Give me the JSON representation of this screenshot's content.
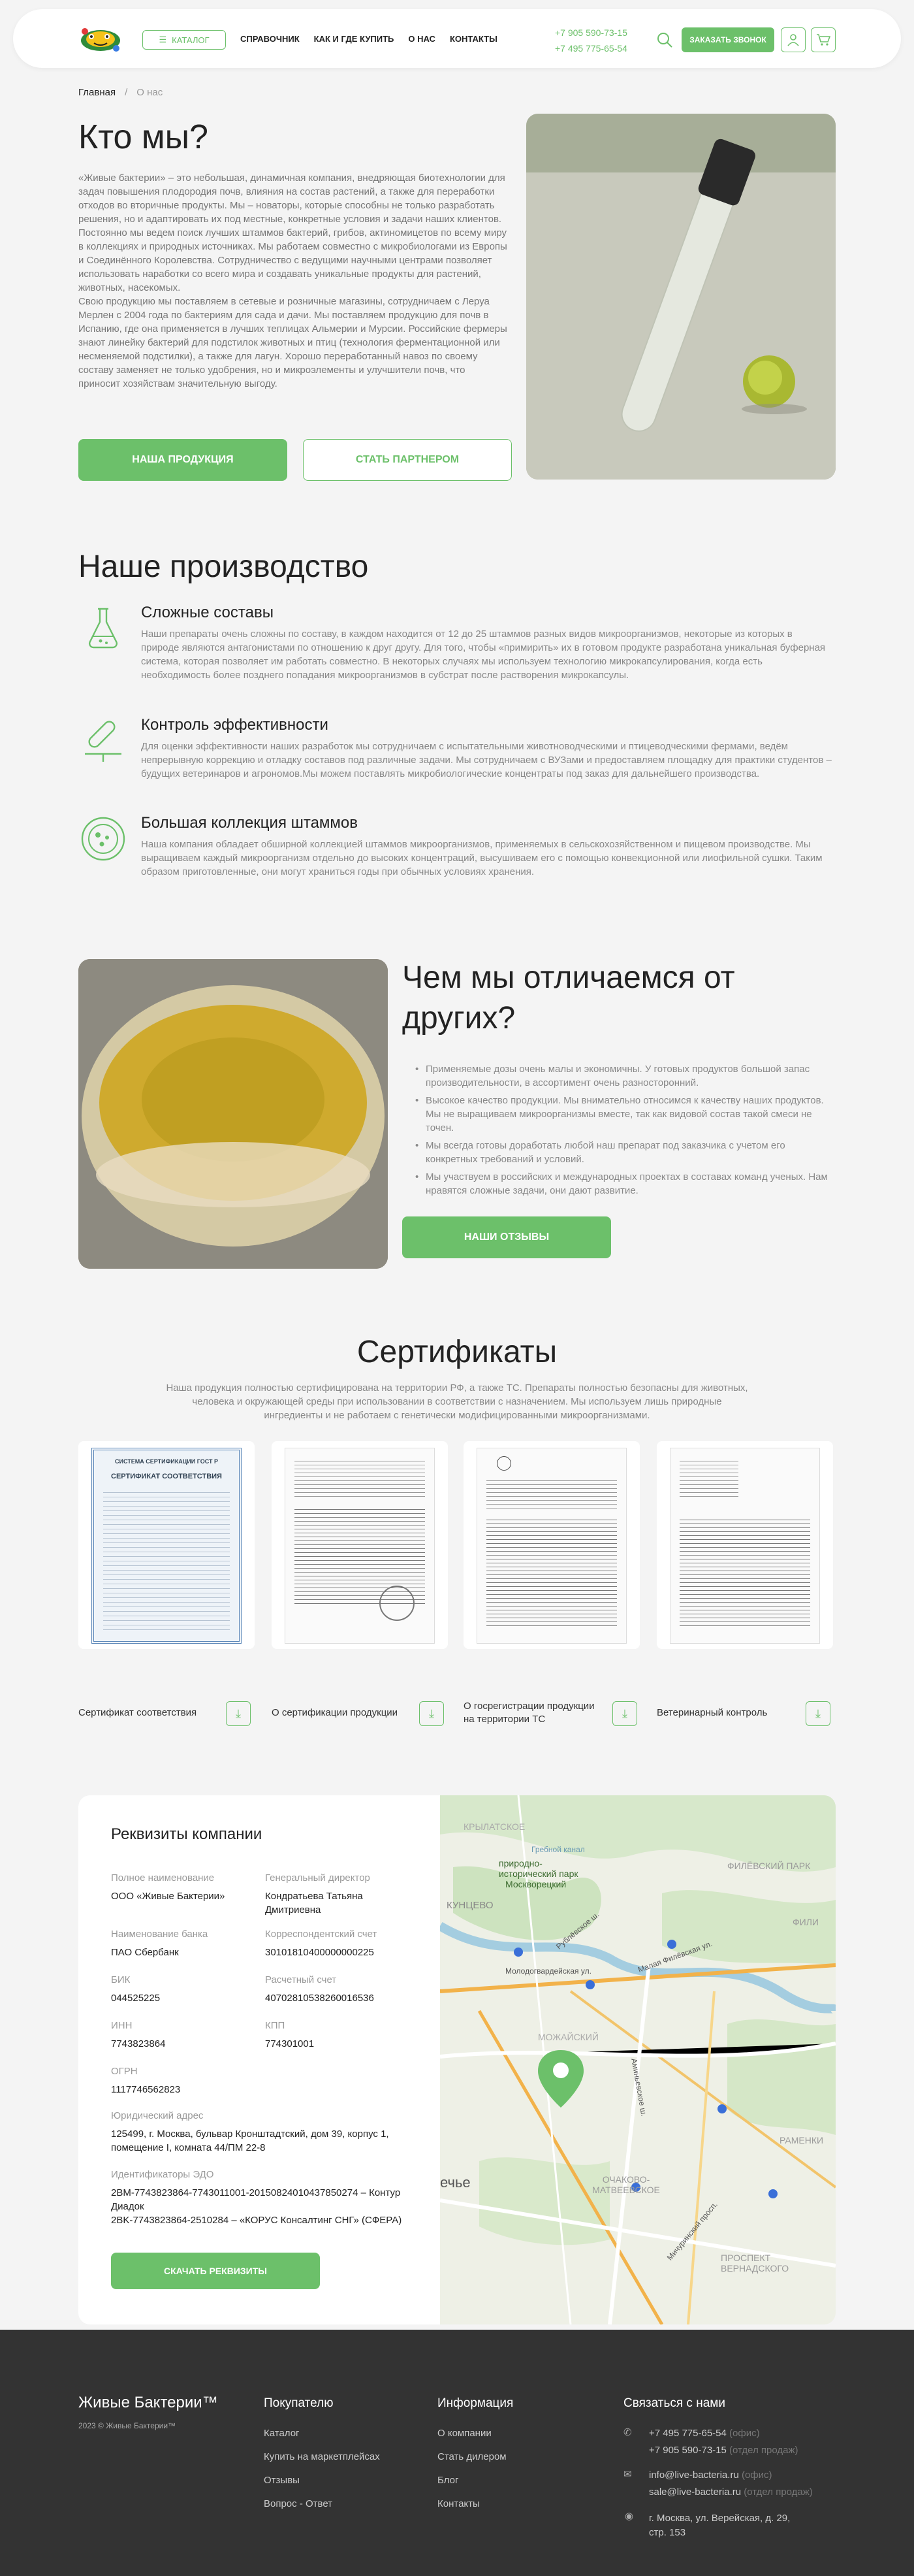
{
  "header": {
    "catalog_label": "Каталог",
    "nav": [
      "Справочник",
      "Как и где купить",
      "О нас",
      "Контакты"
    ],
    "phone1": "+7 905 590-73-15",
    "phone2": "+7 495 775-65-54",
    "call_label": "Заказать звонок"
  },
  "breadcrumb": {
    "home": "Главная",
    "current": "О нас"
  },
  "about": {
    "title": "Кто мы?",
    "p1": "«Живые бактерии» – это небольшая, динамичная компания, внедряющая биотехнологии для задач повышения плодородия почв, влияния на состав растений, а также для переработки отходов во вторичные продукты. Мы – новаторы, которые способны не только разработать решения, но и адаптировать их под местные, конкретные условия и задачи наших клиентов.",
    "p2": "Постоянно мы ведем поиск лучших штаммов бактерий, грибов, актиномицетов по всему миру в коллекциях и природных источниках. Мы работаем совместно с микробиологами из Европы и Соединённого Королевства. Сотрудничество с ведущими научными центрами позволяет использовать наработки со всего мира и создавать уникальные продукты для растений, животных, насекомых.",
    "p3": "Свою продукцию мы поставляем в сетевые и розничные магазины, сотрудничаем с Леруа Мерлен с 2004 года по бактериям для сада и дачи. Мы поставляем продукцию для почв в Испанию, где она применяется в лучших теплицах Альмерии и Мурсии. Российские фермеры знают линейку бактерий для подстилок животных и птиц (технология ферментационной или несменяемой подстилки), а также для лагун. Хорошо переработанный навоз по своему составу заменяет не только удобрения, но и микроэлементы и улучшители почв, что приносит хозяйствам значительную выгоду.",
    "btn_products": "Наша продукция",
    "btn_partner": "Стать партнером"
  },
  "production": {
    "title": "Наше производство",
    "items": [
      {
        "title": "Сложные составы",
        "text": "Наши препараты очень сложны по составу, в каждом находится от 12 до 25 штаммов разных видов микроорганизмов, некоторые из которых в природе являются антагонистами по отношению к друг другу. Для того, чтобы «примирить» их в готовом продукте разработана уникальная буферная система, которая позволяет им работать совместно. В некоторых случаях мы используем технологию микрокапсулирования, когда есть необходимость более позднего попадания микроорганизмов в субстрат после растворения микрокапсулы."
      },
      {
        "title": "Контроль эффективности",
        "text": "Для оценки эффективности наших разработок мы сотрудничаем с испытательными животноводческими и птицеводческими фермами, ведём непрерывную коррекцию и отладку составов под различные задачи. Мы сотрудничаем с ВУЗами и предоставляем площадку для практики студентов – будущих ветеринаров и агрономов.Мы можем поставлять микробиологические концентраты под заказ для дальнейшего производства."
      },
      {
        "title": "Большая коллекция штаммов",
        "text": "Наша компания обладает обширной коллекцией штаммов микроорганизмов, применяемых в сельскохозяйственном и пищевом производстве. Мы выращиваем каждый микроорганизм отдельно до высоких концентраций, высушиваем его с помощью конвекционной или лиофильной сушки. Таким образом приготовленные, они могут храниться годы при обычных условиях хранения."
      }
    ]
  },
  "difference": {
    "title": "Чем мы отличаемся от других?",
    "items": [
      "Применяемые дозы очень малы и экономичны. У готовых продуктов большой запас производительности, в ассортимент очень разносторонний.",
      "Высокое качество продукции. Мы внимательно относимся к качеству наших продуктов. Мы не выращиваем микроорганизмы вместе, так как видовой состав такой смеси не точен.",
      "Мы всегда готовы доработать любой наш препарат под заказчика с учетом его конкретных требований и условий.",
      "Мы участвуем в российских и международных проектах в составах команд ученых. Нам нравятся сложные задачи, они дают развитие."
    ],
    "btn_reviews": "Наши отзывы"
  },
  "certificates": {
    "title": "Сертификаты",
    "intro": "Наша продукция полностью сертифицирована на территории РФ, а также ТС. Препараты полностью безопасны для животных, человека и окружающей среды при использовании в соответствии с назначением. Мы используем лишь природные ингредиенты и не работаем с генетически модифицированными микроорганизмами.",
    "items": [
      {
        "label": "Сертификат соответствия",
        "doc_head": "СИСТЕМА СЕРТИФИКАЦИИ ГОСТ Р",
        "doc_title": "СЕРТИФИКАТ СООТВЕТСТВИЯ"
      },
      {
        "label": "О сертификации продукции"
      },
      {
        "label": "О госрегистрации продукции на территории ТС"
      },
      {
        "label": "Ветеринарный контроль"
      }
    ]
  },
  "requisites": {
    "title": "Реквизиты компании",
    "fields": [
      {
        "label": "Полное наименование",
        "value": "ООО «Живые Бактерии»"
      },
      {
        "label": "Генеральный директор",
        "value": "Кондратьева Татьяна Дмитриевна"
      },
      {
        "label": "Наименование банка",
        "value": "ПАО Сбербанк"
      },
      {
        "label": "Корреспондентский счет",
        "value": "30101810400000000225"
      },
      {
        "label": "БИК",
        "value": "044525225"
      },
      {
        "label": "Расчетный счет",
        "value": "40702810538260016536"
      },
      {
        "label": "ИНН",
        "value": "7743823864"
      },
      {
        "label": "КПП",
        "value": "774301001"
      },
      {
        "label": "ОГРН",
        "value": "1117746562823"
      },
      {
        "label": "Юридический адрес",
        "value": "125499, г. Москва, бульвар Кронштадтский, дом 39, корпус 1, помещение I, комната 44/ПМ 22-8"
      },
      {
        "label": "Идентификаторы ЭДО",
        "value": "2BM-7743823864-7743011001-201508240104378502​74 – Контур Диадок"
      },
      {
        "label": "",
        "value": "2BK-7743823864-2510284 – «КОРУС Консалтинг СНГ» (СФЕРА)"
      }
    ],
    "btn_download": "Скачать реквизиты",
    "map_labels": [
      "КРЫЛАТСКОЕ",
      "Гребной канал",
      "Москворецкий",
      "природно-исторический парк",
      "ФИЛЁВСКИЙ ПАРК",
      "КУНЦЕВО",
      "ФИЛИ",
      "Рублёвское ш.",
      "Молодогвардейская ул.",
      "Малая Филёвская ул.",
      "ОЧАКОВО-МАТВЕЕВСКОЕ",
      "МОЖАЙСКИЙ",
      "РАМЕНКИ",
      "ПРОСПЕКТ ВЕРНАДСКОГО",
      "ечье",
      "Мичуринский просп.",
      "Аминьевское ш."
    ]
  },
  "footer": {
    "brand": "Живые Бактерии™",
    "copyright": "2023 © Живые Бактерии™",
    "col1_title": "Покупателю",
    "col1": [
      "Каталог",
      "Купить на маркетплейсах",
      "Отзывы",
      "Вопрос - Ответ"
    ],
    "col2_title": "Информация",
    "col2": [
      "О компании",
      "Стать дилером",
      "Блог",
      "Контакты"
    ],
    "col3_title": "Связаться с нами",
    "phone1": "+7 495 775-65-54",
    "phone1_note": "(офис)",
    "phone2": "+7 905 590-73-15",
    "phone2_note": "(отдел продаж)",
    "email1": "info@live-bacteria.ru",
    "email1_note": "(офис)",
    "email2": "sale@live-bacteria.ru",
    "email2_note": "(отдел продаж)",
    "address": "г. Москва, ул. Верейская, д. 29, стр. 153"
  },
  "colors": {
    "accent": "#6cc06a",
    "footer_bg": "#333333",
    "page_bg": "#f4f4f4"
  }
}
